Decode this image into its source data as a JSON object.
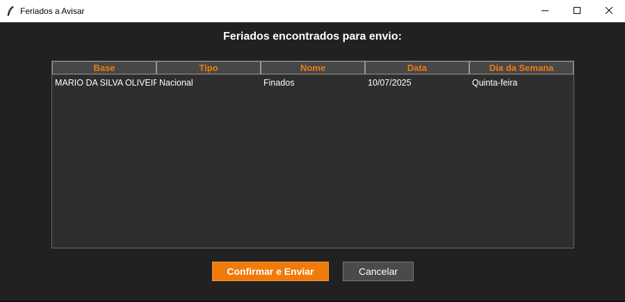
{
  "window": {
    "title": "Feriados a Avisar",
    "app_icon": "feather-icon",
    "controls": [
      "minimize-icon",
      "maximize-icon",
      "close-icon"
    ]
  },
  "heading": "Feriados encontrados para envio:",
  "table": {
    "columns": [
      "Base",
      "Tipo",
      "Nome",
      "Data",
      "Dia da Semana"
    ],
    "rows": [
      [
        "MARIO DA SILVA OLIVEIRA",
        "Nacional",
        "Finados",
        "10/07/2025",
        "Quinta-feira"
      ]
    ]
  },
  "buttons": {
    "confirm": "Confirmar e Enviar",
    "cancel": "Cancelar"
  },
  "colors": {
    "accent": "#f07a0a",
    "background": "#212121",
    "table_background": "#2e2e2e",
    "header_background": "#474747"
  }
}
